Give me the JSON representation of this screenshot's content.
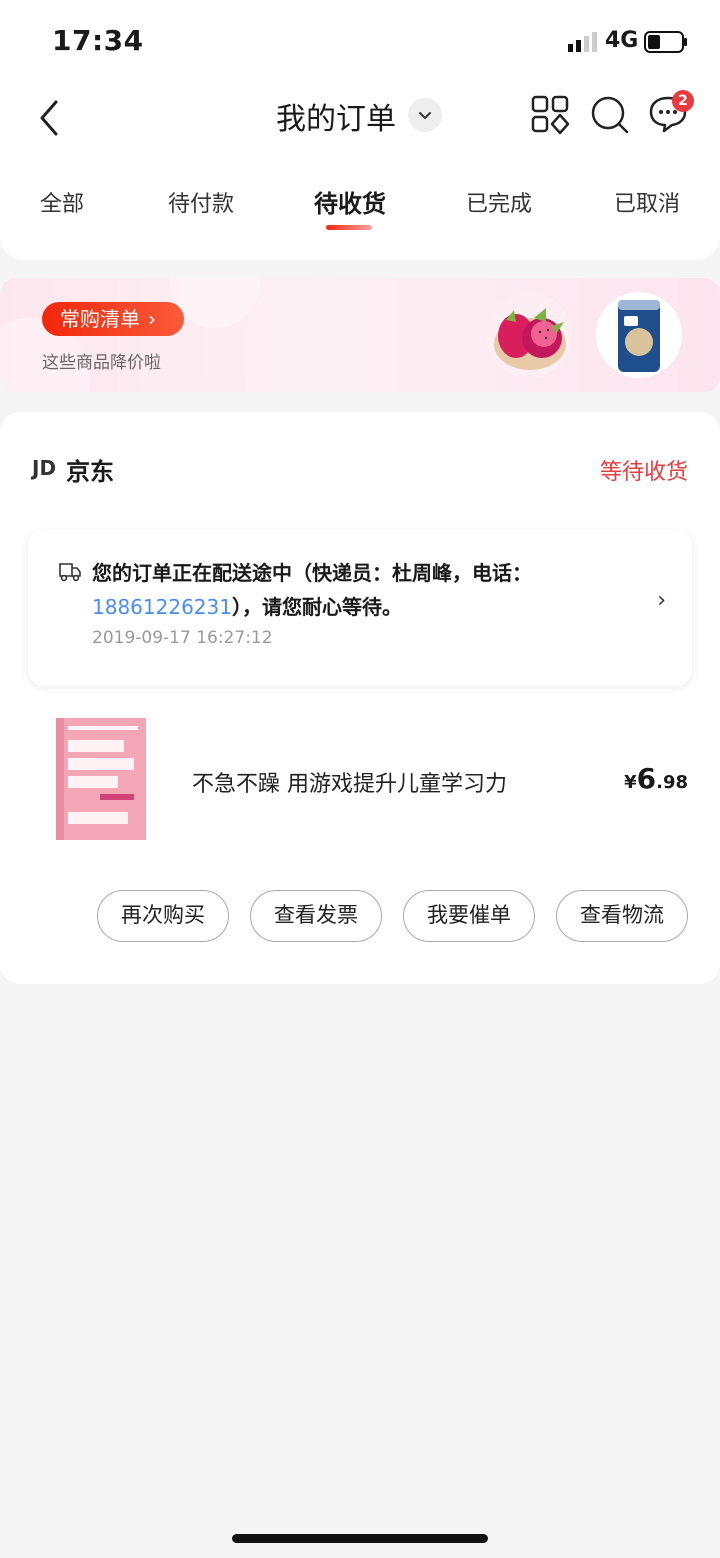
{
  "status_bar": {
    "time": "17:34",
    "network": "4G"
  },
  "header": {
    "title": "我的订单",
    "message_badge": "2",
    "icons": [
      "back-arrow-icon",
      "chevron-down-icon",
      "grid-apps-icon",
      "search-icon",
      "message-icon"
    ]
  },
  "tabs": [
    {
      "label": "全部"
    },
    {
      "label": "待付款"
    },
    {
      "label": "待收货",
      "active": true
    },
    {
      "label": "已完成"
    },
    {
      "label": "已取消"
    }
  ],
  "promo": {
    "button_label": "常购清单",
    "arrow": "›",
    "subtitle": "这些商品降价啦"
  },
  "order": {
    "shop_logo": "JD",
    "shop_name": "京东",
    "status": "等待收货",
    "delivery": {
      "message_before": "您的订单正在配送途中（快递员：杜周峰，电话：",
      "phone": "18861226231",
      "message_after": "），请您耐心等待。",
      "time": "2019-09-17 16:27:12",
      "chevron": "›"
    },
    "product": {
      "name": "不急不躁 用游戏提升儿童学习力",
      "price_symbol": "¥",
      "price_int": "6",
      "price_dec": ".98"
    },
    "actions": [
      {
        "label": "再次购买"
      },
      {
        "label": "查看发票"
      },
      {
        "label": "我要催单"
      },
      {
        "label": "查看物流"
      }
    ]
  },
  "colors": {
    "accent_red": "#e93b3d",
    "link_blue": "#4a8cf7"
  }
}
